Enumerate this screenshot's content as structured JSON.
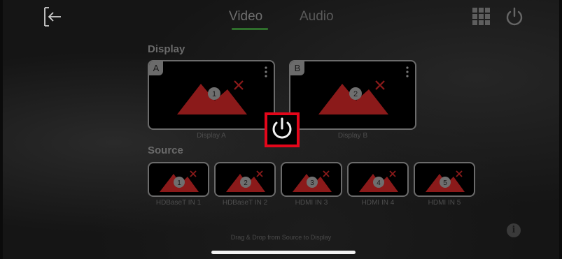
{
  "header": {
    "back_icon": "back-arrow-icon",
    "tabs": [
      {
        "label": "Video",
        "active": true
      },
      {
        "label": "Audio",
        "active": false
      }
    ],
    "grid_icon": "grid-icon",
    "power_icon": "power-icon"
  },
  "display": {
    "section_label": "Display",
    "cards": [
      {
        "letter": "A",
        "number": "1",
        "caption": "Display A"
      },
      {
        "letter": "B",
        "number": "2",
        "caption": "Display B"
      }
    ]
  },
  "source": {
    "section_label": "Source",
    "items": [
      {
        "number": "1",
        "caption": "HDBaseT IN 1"
      },
      {
        "number": "2",
        "caption": "HDBaseT IN 2"
      },
      {
        "number": "3",
        "caption": "HDMI IN 3"
      },
      {
        "number": "4",
        "caption": "HDMI IN 4"
      },
      {
        "number": "5",
        "caption": "HDMI IN 5"
      }
    ]
  },
  "center_power": {
    "icon": "power-icon",
    "highlight_color": "#e3061a"
  },
  "hint": "Drag & Drop from Source to Display",
  "info_icon": "info-icon",
  "colors": {
    "accent_underline": "#2f6e2c",
    "no_signal_red": "#8b1a1a"
  }
}
